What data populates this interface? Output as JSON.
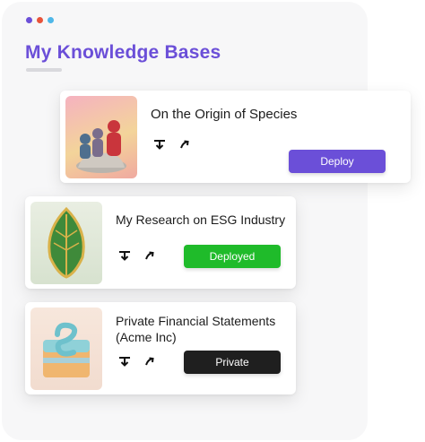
{
  "window": {
    "dots": [
      {
        "name": "dot-purple",
        "color": "#6b4fd8"
      },
      {
        "name": "dot-red",
        "color": "#e8533a"
      },
      {
        "name": "dot-blue",
        "color": "#4fb7e8"
      }
    ]
  },
  "header": {
    "title": "My Knowledge Bases"
  },
  "knowledge_bases": [
    {
      "title": "On the Origin of Species",
      "download_icon": "download-icon",
      "open_icon": "arrow-up-right-icon",
      "button_label": "Deploy",
      "button_color": "#6b4fd8"
    },
    {
      "title": "My Research on ESG Industry",
      "download_icon": "download-icon",
      "open_icon": "arrow-up-right-icon",
      "button_label": "Deployed",
      "button_color": "#1fbb2a"
    },
    {
      "title_line1": "Private Financial Statements",
      "title_line2": "(Acme Inc)",
      "download_icon": "download-icon",
      "open_icon": "arrow-up-right-icon",
      "button_label": "Private",
      "button_color": "#1f1f1f"
    }
  ]
}
